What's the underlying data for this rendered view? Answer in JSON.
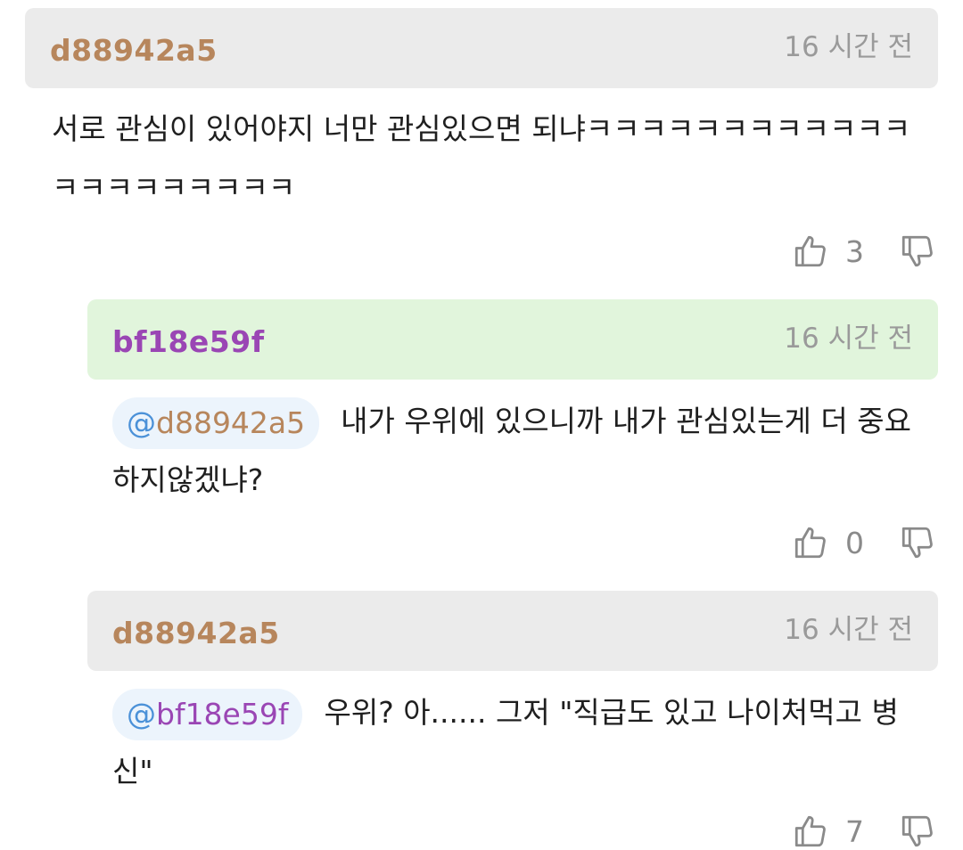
{
  "comments": [
    {
      "author": "d88942a5",
      "time": "16 시간 전",
      "text": "서로 관심이 있어야지 너만 관심있으면 되냐ㅋㅋㅋㅋㅋㅋㅋㅋㅋㅋㅋㅋㅋㅋㅋㅋㅋㅋㅋㅋㅋ",
      "likes": "3"
    },
    {
      "author": "bf18e59f",
      "time": "16 시간 전",
      "mention": "d88942a5",
      "text": "내가 우위에 있으니까 내가 관심있는게 더 중요하지않겠냐?",
      "likes": "0"
    },
    {
      "author": "d88942a5",
      "time": "16 시간 전",
      "mention": "bf18e59f",
      "text": "우위? 아...... 그저 \"직급도 있고 나이처먹고 병신\"",
      "likes": "7"
    }
  ],
  "mention_prefix": "@",
  "icons": {
    "like": "thumbs-up-icon",
    "dislike": "thumbs-down-icon"
  },
  "colors": {
    "header_gray": "#ebebeb",
    "header_green": "#e1f5dc",
    "author_brown": "#b7865c",
    "author_purple": "#9a46b4",
    "mention_blue": "#4b91d8"
  }
}
